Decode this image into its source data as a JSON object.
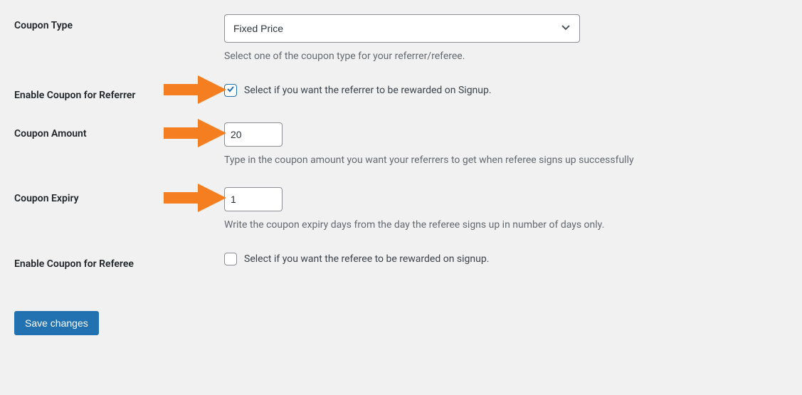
{
  "fields": {
    "coupon_type": {
      "label": "Coupon Type",
      "value": "Fixed Price",
      "hint": "Select one of the coupon type for your referrer/referee."
    },
    "enable_referrer": {
      "label": "Enable Coupon for Referrer",
      "checked": true,
      "description": "Select if you want the referrer to be rewarded on Signup."
    },
    "coupon_amount": {
      "label": "Coupon Amount",
      "value": "20",
      "hint": "Type in the coupon amount you want your referrers to get when referee signs up successfully"
    },
    "coupon_expiry": {
      "label": "Coupon Expiry",
      "value": "1",
      "hint": "Write the coupon expiry days from the day the referee signs up in number of days only."
    },
    "enable_referee": {
      "label": "Enable Coupon for Referee",
      "checked": false,
      "description": "Select if you want the referee to be rewarded on signup."
    }
  },
  "buttons": {
    "save": "Save changes"
  },
  "colors": {
    "arrow": "#f57e20",
    "primary": "#2271b1"
  }
}
